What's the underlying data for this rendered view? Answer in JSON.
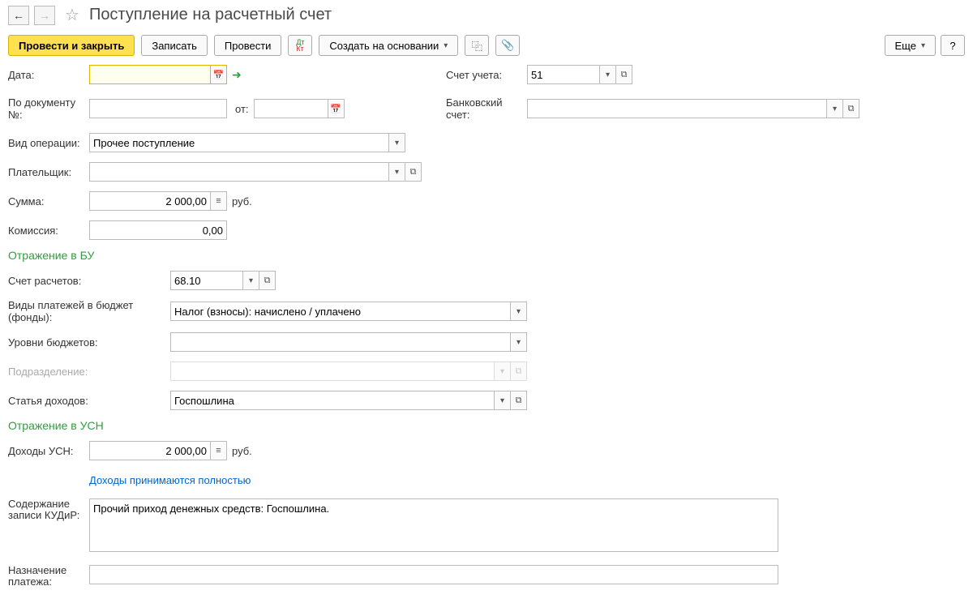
{
  "header": {
    "title": "Поступление на расчетный счет"
  },
  "toolbar": {
    "post_close": "Провести и закрыть",
    "save": "Записать",
    "post": "Провести",
    "create_based": "Создать на основании",
    "more": "Еще",
    "help": "?"
  },
  "labels": {
    "date": "Дата:",
    "doc_no": "По документу №:",
    "from": "от:",
    "op_type": "Вид операции:",
    "payer": "Плательщик:",
    "sum": "Сумма:",
    "currency": "руб.",
    "commission": "Комиссия:",
    "account": "Счет учета:",
    "bank_account": "Банковский счет:",
    "section_bu": "Отражение в БУ",
    "settlement_account": "Счет расчетов:",
    "budget_payment_types": "Виды платежей в бюджет (фонды):",
    "budget_levels": "Уровни бюджетов:",
    "department": "Подразделение:",
    "income_item": "Статья доходов:",
    "section_usn": "Отражение в УСН",
    "usn_income": "Доходы УСН:",
    "income_full": "Доходы принимаются полностью",
    "kudir_label1": "Содержание",
    "kudir_label2": "записи КУДиР:",
    "purpose1": "Назначение",
    "purpose2": "платежа:"
  },
  "values": {
    "date": "",
    "doc_no": "",
    "from": "",
    "op_type": "Прочее поступление",
    "payer": "",
    "sum": "2 000,00",
    "commission": "0,00",
    "account": "51",
    "bank_account": "",
    "settlement_account": "68.10",
    "budget_payment_types": "Налог (взносы): начислено / уплачено",
    "budget_levels": "",
    "department": "",
    "income_item": "Госпошлина",
    "usn_income": "2 000,00",
    "kudir": "Прочий приход денежных средств: Госпошлина.",
    "purpose": ""
  }
}
